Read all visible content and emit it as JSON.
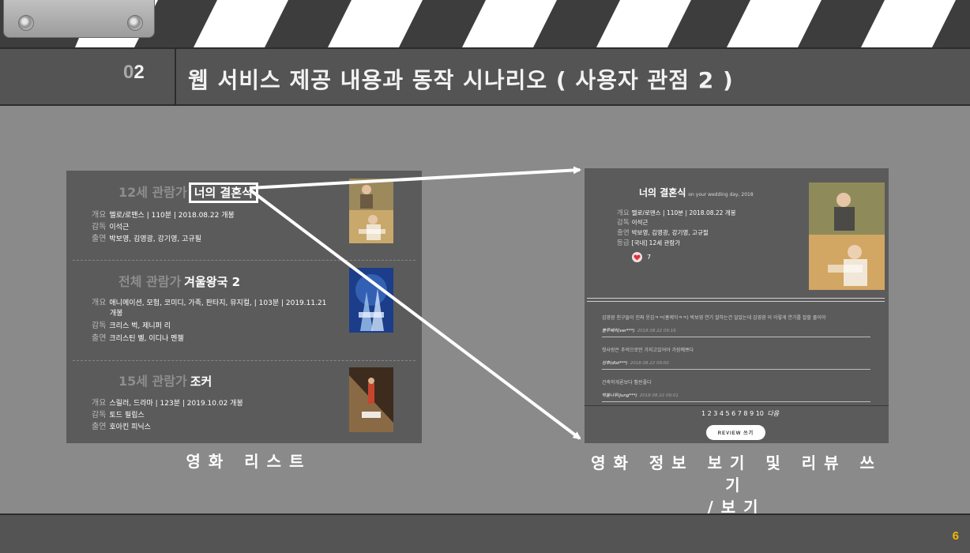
{
  "header": {
    "section_number": "02",
    "section_number_lead": "0",
    "section_number_main": "2",
    "title": "웹 서비스 제공 내용과 동작 시나리오 ( 사용자 관점 2 )"
  },
  "footer": {
    "page_number": "6"
  },
  "movie_list": {
    "items": [
      {
        "rating": "12세 관람가",
        "title": "너의 결혼식",
        "overview_label": "개요",
        "overview": "멜로/로맨스 | 110분 | 2018.08.22 개봉",
        "director_label": "감독",
        "director": "이석근",
        "cast_label": "출연",
        "cast": "박보영, 김영광, 강기영, 고규필"
      },
      {
        "rating": "전체 관람가",
        "title": "겨울왕국 2",
        "overview_label": "개요",
        "overview": "애니메이션, 모험, 코미디, 가족, 판타지, 뮤지컬, | 103분 | 2019.11.21",
        "overview_cont": "개봉",
        "director_label": "감독",
        "director": "크리스 벅, 제니퍼 리",
        "cast_label": "출연",
        "cast": "크리스틴 벨, 이디나 멘젤"
      },
      {
        "rating": "15세 관람가",
        "title": "조커",
        "overview_label": "개요",
        "overview": "스릴러, 드라마 | 123분 | 2019.10.02 개봉",
        "director_label": "감독",
        "director": "토드 필립스",
        "cast_label": "출연",
        "cast": "호아킨 피닉스"
      }
    ]
  },
  "movie_detail": {
    "title": "너의 결혼식",
    "subtitle": "on your wedding day, 2018",
    "overview_label": "개요",
    "overview": "멜로/로맨스 | 110분 | 2018.08.22 개봉",
    "director_label": "감독",
    "director": "이석근",
    "cast_label": "출연",
    "cast": "박보영, 김영광, 강기영, 고규필",
    "grade_label": "등급",
    "grade": "[국내] 12세 관람가",
    "like_count": "7",
    "reviews": [
      {
        "text": "김영광 친구들이 진짜 웃김ㅋㅋ(홍케익ㅋㅋ) 박보영 연기 잘하는건 알았는데 김영광 이 이렇게 연기를 잘할 줄이야",
        "author": "블루베리(ver***)",
        "date": "2018.08.22 09:16"
      },
      {
        "text": "첫사랑은 추억으로만 가지고있어야 가장예쁘다",
        "author": "성후(dlst***)",
        "date": "2018.08.22 09:00"
      },
      {
        "text": "건축학개론보다 훨씬좋다",
        "author": "박봄나무(jung***)",
        "date": "2018.08.22 09:01"
      }
    ],
    "pages": "1 2 3 4 5 6 7 8 9 10",
    "next_label": "다음",
    "review_button": "REVIEW 쓰기"
  },
  "captions": {
    "left": "영화 리스트",
    "right_line1": "영화 정보 보기 및 리뷰 쓰기",
    "right_line2": "/보기"
  },
  "colors": {
    "background": "#8a8a8a",
    "bar": "#545454",
    "panel": "#5b5b5b",
    "page_number": "#f0b800",
    "heart": "#e0333f"
  }
}
